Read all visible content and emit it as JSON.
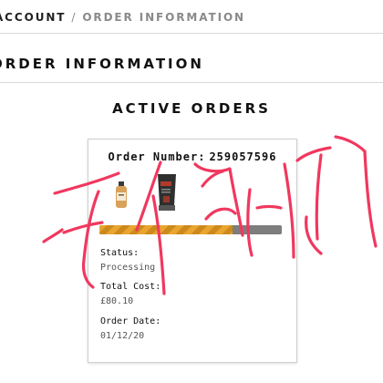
{
  "breadcrumb": {
    "account": "ACCOUNT",
    "separator": "/",
    "current": "ORDER INFORMATION"
  },
  "page_title": "ORDER INFORMATION",
  "section_title": "ACTIVE ORDERS",
  "order": {
    "number_label": "Order Number:",
    "number": "259057596",
    "progress_fraction": 0.73,
    "status_label": "Status:",
    "status": "Processing",
    "total_label": "Total Cost:",
    "total": "£80.10",
    "date_label": "Order Date:",
    "date": "01/12/20"
  },
  "colors": {
    "progress_fill": "#e9a52f",
    "progress_track": "#7d7d7d",
    "scribble": "#f0385f"
  },
  "icons": [
    "small-bottle-icon",
    "tube-bottle-icon"
  ]
}
